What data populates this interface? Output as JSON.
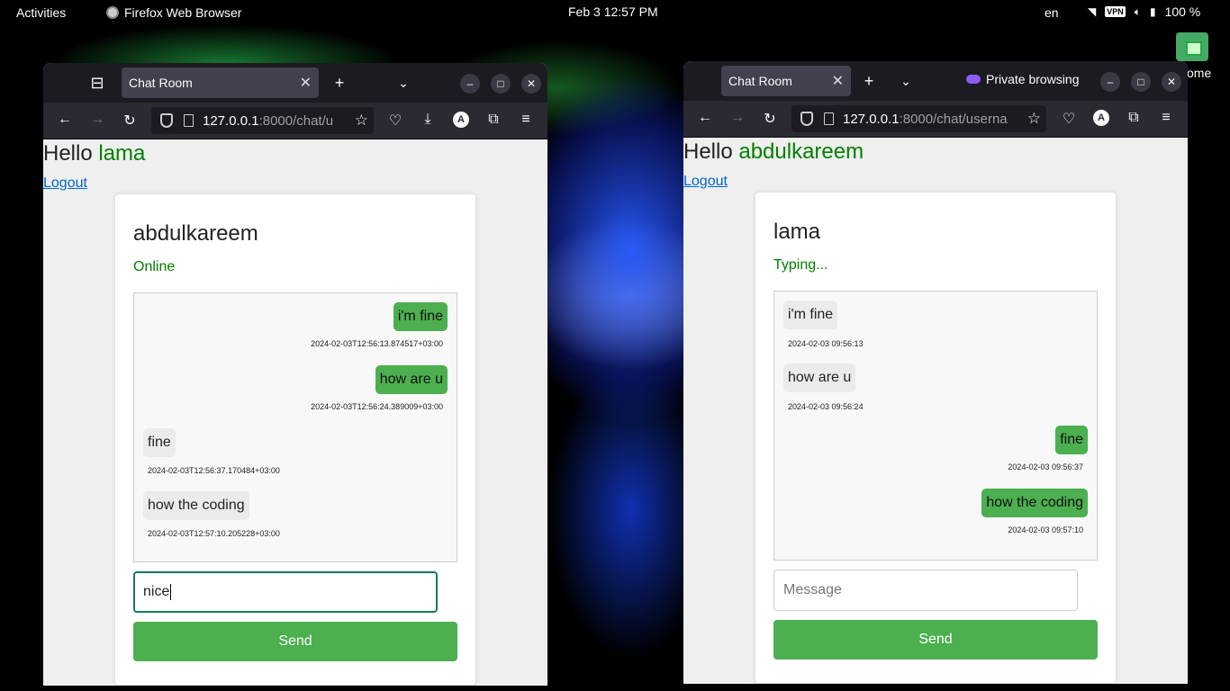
{
  "topbar": {
    "activities": "Activities",
    "app_name": "Firefox Web Browser",
    "clock": "Feb 3  12:57 PM",
    "language": "en",
    "vpn": "VPN",
    "battery": "100 %"
  },
  "desktop": {
    "home_label": "ome"
  },
  "left_window": {
    "tab_title": "Chat Room",
    "url_host": "127.0.0.1",
    "url_rest": ":8000/chat/u",
    "page": {
      "greeting_prefix": "Hello ",
      "username": "lama",
      "logout": "Logout",
      "partner_name": "abdulkareem",
      "partner_status": "Online",
      "messages": [
        {
          "text": "i'm fine",
          "ts": "2024-02-03T12:56:13.874517+03:00",
          "side": "sent"
        },
        {
          "text": "how are u",
          "ts": "2024-02-03T12:56:24.389009+03:00",
          "side": "sent"
        },
        {
          "text": "fine",
          "ts": "2024-02-03T12:56:37.170484+03:00",
          "side": "recv"
        },
        {
          "text": "how the coding",
          "ts": "2024-02-03T12:57:10.205228+03:00",
          "side": "recv"
        }
      ],
      "input_value": "nice",
      "input_placeholder": "",
      "send_label": "Send"
    }
  },
  "right_window": {
    "tab_title": "Chat Room",
    "private_label": "Private browsing",
    "url_host": "127.0.0.1",
    "url_rest": ":8000/chat/userna",
    "page": {
      "greeting_prefix": "Hello ",
      "username": "abdulkareem",
      "logout": "Logout",
      "partner_name": "lama",
      "partner_status": "Typing...",
      "messages": [
        {
          "text": "i'm fine",
          "ts": "2024-02-03 09:56:13",
          "side": "recv"
        },
        {
          "text": "how are u",
          "ts": "2024-02-03 09:56:24",
          "side": "recv"
        },
        {
          "text": "fine",
          "ts": "2024-02-03 09:56:37",
          "side": "sent"
        },
        {
          "text": "how the coding",
          "ts": "2024-02-03 09:57:10",
          "side": "sent"
        }
      ],
      "input_value": "",
      "input_placeholder": "Message",
      "send_label": "Send"
    }
  },
  "colors": {
    "accent_green": "#4caf50",
    "username_green": "#008000",
    "link_blue": "#0066cc",
    "private_purple": "#8b5cf6"
  }
}
